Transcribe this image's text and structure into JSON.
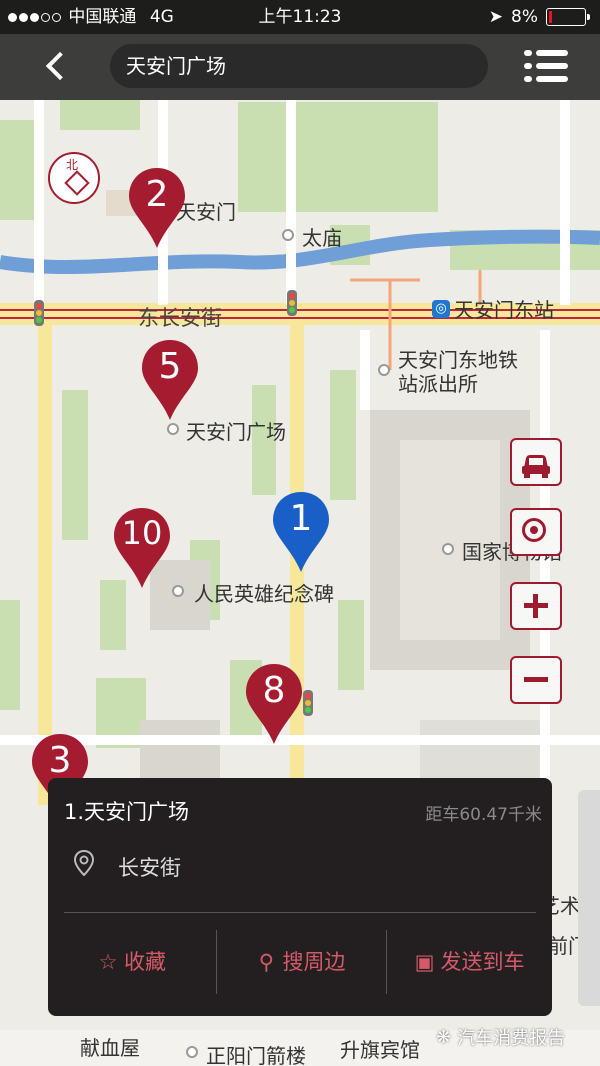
{
  "status_bar": {
    "carrier": "中国联通",
    "network": "4G",
    "time": "上午11:23",
    "battery": "8%"
  },
  "nav": {
    "search_value": "天安门广场"
  },
  "map_labels": {
    "tiananmen": "天安门",
    "taimiao": "太庙",
    "changan_street": "东长安街",
    "subway_station": "天安门东站",
    "police_station_line1": "天安门东地铁",
    "police_station_line2": "站派出所",
    "square": "天安门广场",
    "museum": "国家博物馆",
    "monument": "人民英雄纪念碑",
    "xianxue": "献血屋",
    "zhengyangmen": "正阳门箭楼",
    "shengqi": "升旗宾馆",
    "art_partial": "艺术馆",
    "qianmen_partial": "前门"
  },
  "pins": [
    {
      "number": "2",
      "color": "#a51c30"
    },
    {
      "number": "5",
      "color": "#a51c30"
    },
    {
      "number": "10",
      "color": "#a51c30"
    },
    {
      "number": "1",
      "color": "#1a5fc8"
    },
    {
      "number": "8",
      "color": "#a51c30"
    },
    {
      "number": "3",
      "color": "#a51c30"
    }
  ],
  "controls": {
    "car_icon": "car-icon",
    "locate_icon": "locate-icon",
    "zoom_in": "plus-icon",
    "zoom_out": "minus-icon"
  },
  "panel": {
    "title": "1.天安门广场",
    "distance": "距车60.47千米",
    "address": "长安街",
    "favorite_label": "收藏",
    "nearby_label": "搜周边",
    "send_label": "发送到车"
  },
  "watermark": "汽车消费报告",
  "colors": {
    "accent": "#a51c30",
    "selected_pin": "#1a5fc8",
    "panel_bg": "#231f20",
    "action_text": "#d45a69"
  }
}
